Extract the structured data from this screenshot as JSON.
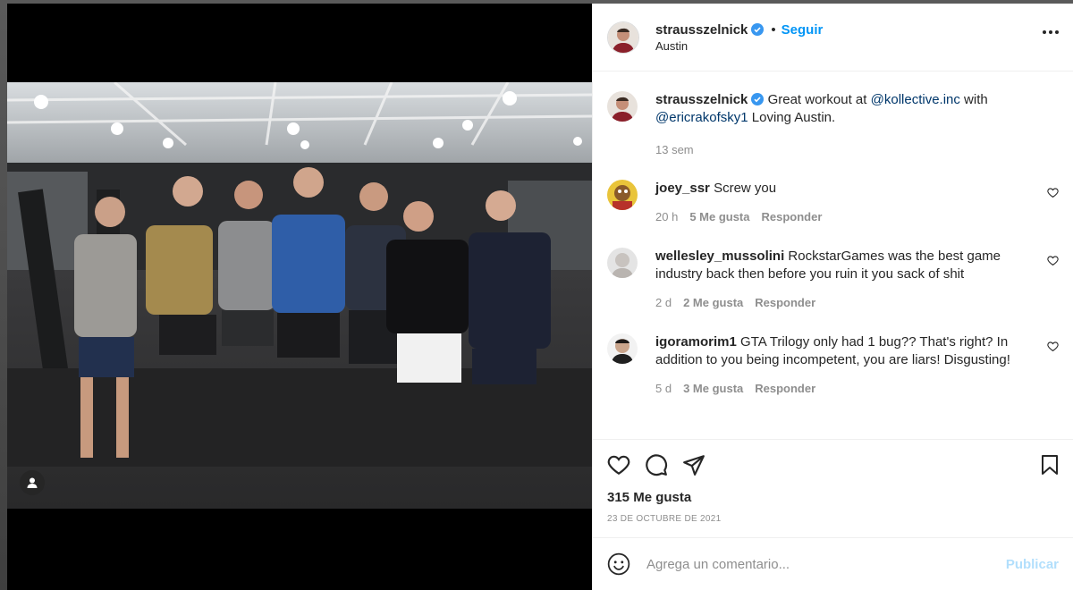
{
  "post": {
    "author": "strausszelnick",
    "follow_label": "Seguir",
    "dot": "•",
    "location": "Austin",
    "caption_text_1": "Great workout at ",
    "caption_mention_1": "@kollective.inc",
    "caption_text_2": " with ",
    "caption_mention_2": "@ericrakofsky1",
    "caption_text_3": " Loving Austin.",
    "caption_time": "13 sem",
    "likes": "315 Me gusta",
    "date": "23 DE OCTUBRE DE 2021"
  },
  "comments": [
    {
      "user": "joey_ssr",
      "text": "Screw you",
      "time": "20 h",
      "likes": "5 Me gusta",
      "reply": "Responder"
    },
    {
      "user": "wellesley_mussolini",
      "text": "RockstarGames was the best game industry back then before you ruin it you sack of shit",
      "time": "2 d",
      "likes": "2 Me gusta",
      "reply": "Responder"
    },
    {
      "user": "igoramorim1",
      "text": "GTA Trilogy only had 1 bug?? That's right? In addition to you being incompetent, you are liars! Disgusting!",
      "time": "5 d",
      "likes": "3 Me gusta",
      "reply": "Responder"
    }
  ],
  "composer": {
    "placeholder": "Agrega un comentario...",
    "publish_label": "Publicar"
  },
  "colors": {
    "accent": "#0095f6",
    "verified": "#3897f0",
    "muted": "#8e8e8e"
  },
  "icons": [
    "verified-badge-icon",
    "more-options-icon",
    "heart-icon",
    "comment-icon",
    "share-icon",
    "bookmark-icon",
    "emoji-icon",
    "user-tag-icon"
  ]
}
